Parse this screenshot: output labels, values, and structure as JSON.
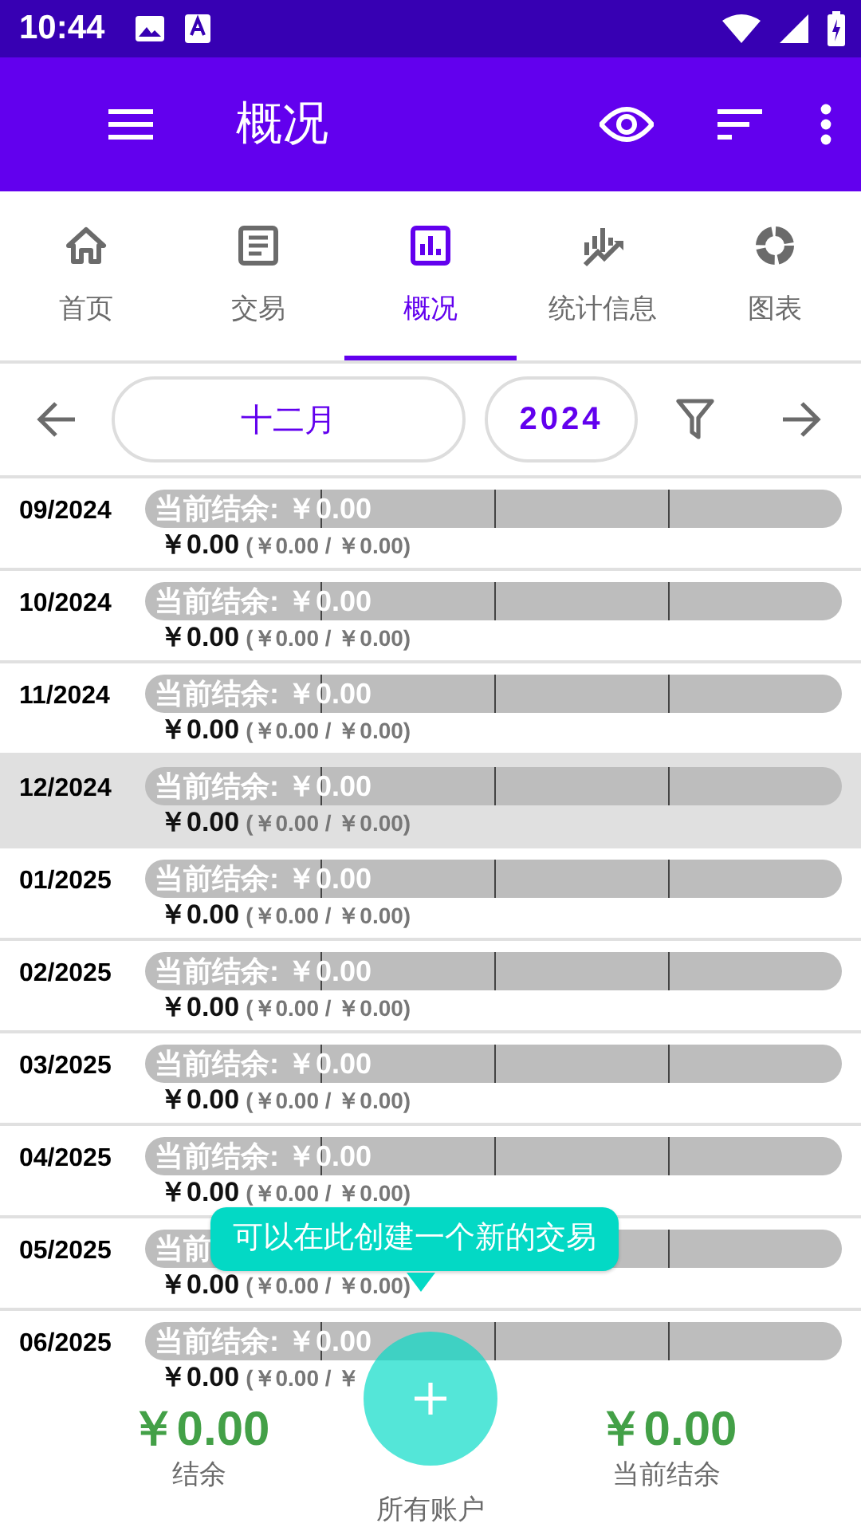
{
  "status_bar": {
    "time": "10:44"
  },
  "app_bar": {
    "title": "概况"
  },
  "tabs": [
    {
      "label": "首页",
      "selected": false
    },
    {
      "label": "交易",
      "selected": false
    },
    {
      "label": "概况",
      "selected": true
    },
    {
      "label": "统计信息",
      "selected": false
    },
    {
      "label": "图表",
      "selected": false
    }
  ],
  "period": {
    "month": "十二月",
    "year": "2024"
  },
  "rows": [
    {
      "month": "09/2024",
      "bar_label": "当前结余: ￥0.00",
      "total": "￥0.00",
      "detail": "(￥0.00 / ￥0.00)",
      "selected": false
    },
    {
      "month": "10/2024",
      "bar_label": "当前结余: ￥0.00",
      "total": "￥0.00",
      "detail": "(￥0.00 / ￥0.00)",
      "selected": false
    },
    {
      "month": "11/2024",
      "bar_label": "当前结余: ￥0.00",
      "total": "￥0.00",
      "detail": "(￥0.00 / ￥0.00)",
      "selected": false
    },
    {
      "month": "12/2024",
      "bar_label": "当前结余: ￥0.00",
      "total": "￥0.00",
      "detail": "(￥0.00 / ￥0.00)",
      "selected": true
    },
    {
      "month": "01/2025",
      "bar_label": "当前结余: ￥0.00",
      "total": "￥0.00",
      "detail": "(￥0.00 / ￥0.00)",
      "selected": false
    },
    {
      "month": "02/2025",
      "bar_label": "当前结余: ￥0.00",
      "total": "￥0.00",
      "detail": "(￥0.00 / ￥0.00)",
      "selected": false
    },
    {
      "month": "03/2025",
      "bar_label": "当前结余: ￥0.00",
      "total": "￥0.00",
      "detail": "(￥0.00 / ￥0.00)",
      "selected": false
    },
    {
      "month": "04/2025",
      "bar_label": "当前结余: ￥0.00",
      "total": "￥0.00",
      "detail": "(￥0.00 / ￥0.00)",
      "selected": false
    },
    {
      "month": "05/2025",
      "bar_label": "当前",
      "total": "￥0.00",
      "detail": "(￥0.00 / ￥0.00)",
      "selected": false
    },
    {
      "month": "06/2025",
      "bar_label": "当前结余: ￥0.00",
      "total": "￥0.00",
      "detail": "(￥0.00 / ￥",
      "selected": false
    }
  ],
  "tooltip": {
    "text": "可以在此创建一个新的交易"
  },
  "footer": {
    "balance": "￥0.00",
    "balance_label": "结余",
    "current": "￥0.00",
    "current_label": "当前结余",
    "account": "所有账户"
  }
}
